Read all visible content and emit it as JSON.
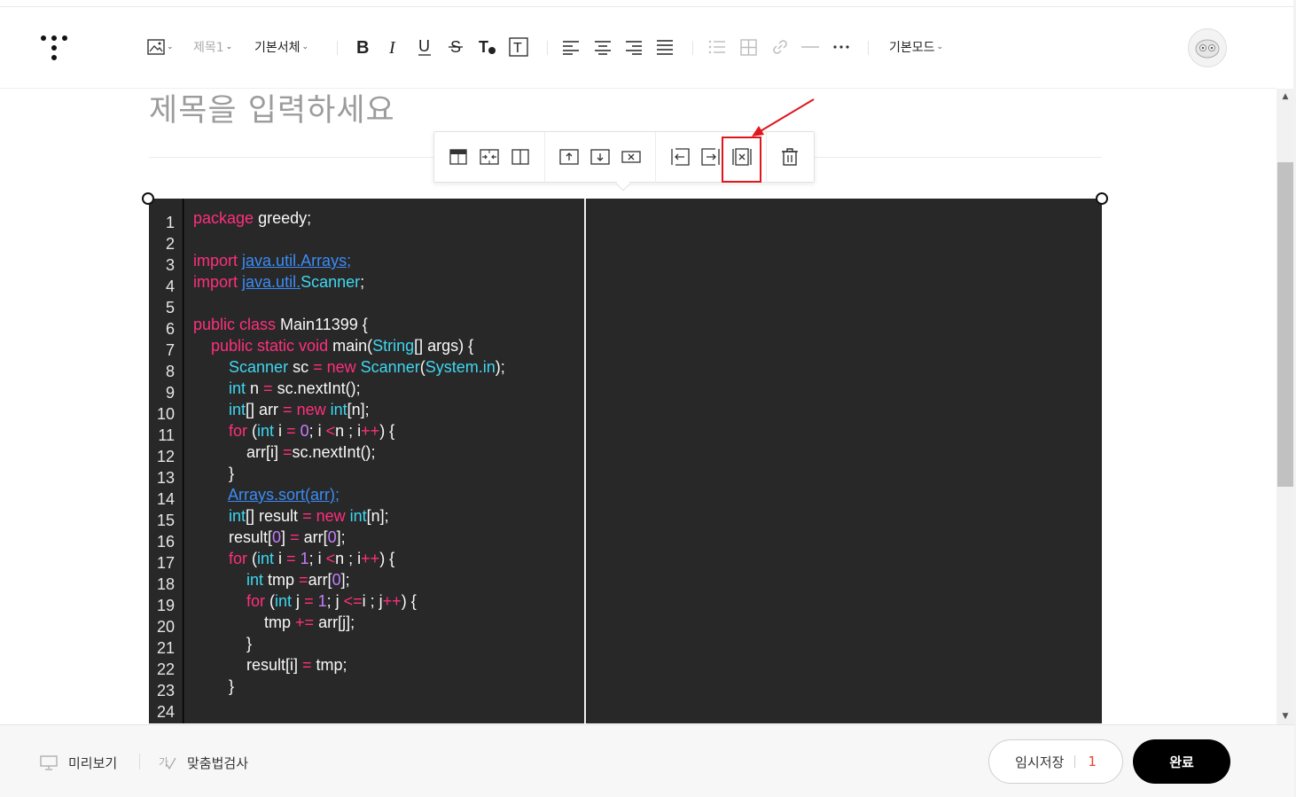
{
  "toolbar": {
    "heading_label": "제목1",
    "font_label": "기본서체",
    "mode_label": "기본모드",
    "icons": [
      "image-icon",
      "bold-icon",
      "italic-icon",
      "underline-icon",
      "strikethrough-icon",
      "text-color-icon",
      "text-background-icon",
      "align-left-icon",
      "align-center-icon",
      "align-right-icon",
      "align-justify-icon",
      "list-icon",
      "table-icon",
      "link-icon",
      "divider-icon",
      "more-icon"
    ]
  },
  "editor": {
    "title_placeholder": "제목을 입력하세요"
  },
  "table_toolbar": {
    "icons": [
      "table-header-icon",
      "merge-cells-icon",
      "split-cells-icon",
      "insert-row-above-icon",
      "insert-row-below-icon",
      "delete-row-icon",
      "insert-col-left-icon",
      "insert-col-right-icon",
      "delete-col-icon",
      "delete-table-icon"
    ],
    "highlighted": "delete-col-icon",
    "annotation_color": "#e0161d"
  },
  "code": {
    "line_numbers": [
      "1",
      "2",
      "3",
      "4",
      "5",
      "6",
      "7",
      "8",
      "9",
      "10",
      "11",
      "12",
      "13",
      "14",
      "15",
      "16",
      "17",
      "18",
      "19",
      "20",
      "21",
      "22",
      "23",
      "24"
    ],
    "lines": [
      "package greedy;",
      "",
      "import java.util.Arrays;",
      "import java.util.Scanner;",
      "",
      "public class Main11399 {",
      "    public static void main(String[] args) {",
      "        Scanner sc = new Scanner(System.in);",
      "        int n = sc.nextInt();",
      "        int[] arr = new int[n];",
      "        for (int i = 0; i <n ; i++) {",
      "            arr[i] =sc.nextInt();",
      "        }",
      "        Arrays.sort(arr);",
      "        int[] result = new int[n];",
      "        result[0] = arr[0];",
      "        for (int i = 1; i <n ; i++) {",
      "            int tmp =arr[0];",
      "            for (int j = 1; j <=i ; j++) {",
      "                tmp += arr[j];",
      "            }",
      "            result[i] = tmp;",
      "        }",
      ""
    ],
    "colors": {
      "keyword": "#ff2f7c",
      "type": "#3fd7f0",
      "number": "#c67cff",
      "link": "#3b8cf5",
      "background": "#282828"
    }
  },
  "footer": {
    "preview_label": "미리보기",
    "spellcheck_label": "맞춤법검사",
    "temp_save_label": "임시저장",
    "temp_save_count": "1",
    "done_label": "완료"
  }
}
